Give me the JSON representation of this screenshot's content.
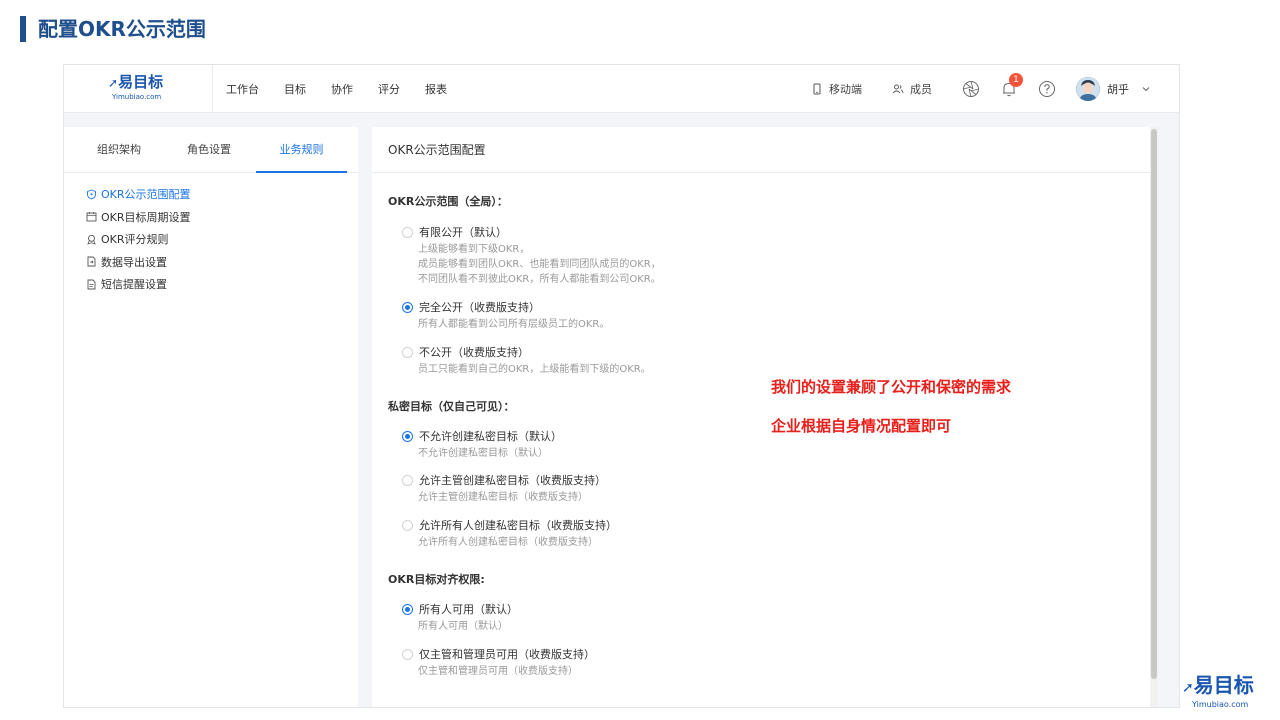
{
  "slide": {
    "title": "配置OKR公示范围"
  },
  "brand": {
    "logo_text": "易目标",
    "logo_sub": "Yimubiao.com",
    "color": "#1a56b0"
  },
  "topnav": {
    "menu": [
      "工作台",
      "目标",
      "协作",
      "评分",
      "报表"
    ],
    "mobile_label": "移动端",
    "members_label": "成员",
    "notification_count": "1",
    "user_name": "胡乎"
  },
  "left_panel": {
    "tabs": [
      "组织架构",
      "角色设置",
      "业务规则"
    ],
    "active_tab": 2,
    "items": [
      "OKR公示范围配置",
      "OKR目标周期设置",
      "OKR评分规则",
      "数据导出设置",
      "短信提醒设置"
    ]
  },
  "right_panel": {
    "header": "OKR公示范围配置",
    "sections": [
      {
        "title": "OKR公示范围（全局）：",
        "options": [
          {
            "label": "有限公开（默认）",
            "checked": false,
            "desc": [
              "上级能够看到下级OKR，",
              "成员能够看到团队OKR、也能看到同团队成员的OKR，",
              "不同团队看不到彼此OKR，所有人都能看到公司OKR。"
            ]
          },
          {
            "label": "完全公开（收费版支持）",
            "checked": true,
            "desc": [
              "所有人都能看到公司所有层级员工的OKR。"
            ]
          },
          {
            "label": "不公开（收费版支持）",
            "checked": false,
            "desc": [
              "员工只能看到自己的OKR，上级能看到下级的OKR。"
            ]
          }
        ]
      },
      {
        "title": "私密目标（仅自己可见）：",
        "options": [
          {
            "label": "不允许创建私密目标（默认）",
            "checked": true,
            "desc": [
              "不允许创建私密目标（默认）"
            ]
          },
          {
            "label": "允许主管创建私密目标（收费版支持）",
            "checked": false,
            "desc": [
              "允许主管创建私密目标（收费版支持）"
            ]
          },
          {
            "label": "允许所有人创建私密目标（收费版支持）",
            "checked": false,
            "desc": [
              "允许所有人创建私密目标（收费版支持）"
            ]
          }
        ]
      },
      {
        "title": "OKR目标对齐权限:",
        "options": [
          {
            "label": "所有人可用（默认）",
            "checked": true,
            "desc": [
              "所有人可用（默认）"
            ]
          },
          {
            "label": "仅主管和管理员可用（收费版支持）",
            "checked": false,
            "desc": [
              "仅主管和管理员可用（收费版支持）"
            ]
          }
        ]
      }
    ]
  },
  "annotations": [
    "我们的设置兼顾了公开和保密的需求",
    "企业根据自身情况配置即可"
  ],
  "colors": {
    "accent": "#1a73e8",
    "title": "#1f4e8c",
    "annotation": "#e8201c",
    "badge": "#f5543a"
  }
}
